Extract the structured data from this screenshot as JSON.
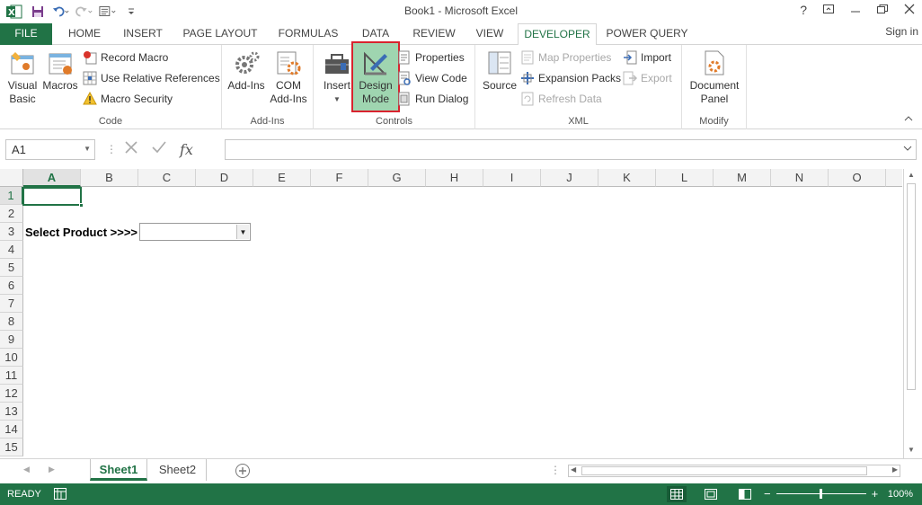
{
  "app": {
    "title": "Book1 - Microsoft Excel",
    "sign_in": "Sign in",
    "brand_color": "#217346"
  },
  "tabs": [
    "FILE",
    "HOME",
    "INSERT",
    "PAGE LAYOUT",
    "FORMULAS",
    "DATA",
    "REVIEW",
    "VIEW",
    "DEVELOPER",
    "POWER QUERY"
  ],
  "active_tab": "DEVELOPER",
  "ribbon": {
    "code": {
      "label": "Code",
      "visual_basic": [
        "Visual",
        "Basic"
      ],
      "macros": "Macros",
      "record_macro": "Record Macro",
      "use_relative": "Use Relative References",
      "macro_security": "Macro Security"
    },
    "addins": {
      "label": "Add-Ins",
      "add_ins": "Add-Ins",
      "com_add_ins": [
        "COM",
        "Add-Ins"
      ]
    },
    "controls": {
      "label": "Controls",
      "insert": "Insert",
      "design_mode": [
        "Design",
        "Mode"
      ],
      "properties": "Properties",
      "view_code": "View Code",
      "run_dialog": "Run Dialog"
    },
    "xml": {
      "label": "XML",
      "source": "Source",
      "map_properties": "Map Properties",
      "expansion_packs": "Expansion Packs",
      "refresh_data": "Refresh Data",
      "import": "Import",
      "export": "Export"
    },
    "modify": {
      "label": "Modify",
      "document_panel": [
        "Document",
        "Panel"
      ]
    }
  },
  "formula_bar": {
    "name_box": "A1",
    "fx": "fx",
    "value": ""
  },
  "grid": {
    "columns": [
      "A",
      "B",
      "C",
      "D",
      "E",
      "F",
      "G",
      "H",
      "I",
      "J",
      "K",
      "L",
      "M",
      "N",
      "O"
    ],
    "rows": [
      "1",
      "2",
      "3",
      "4",
      "5",
      "6",
      "7",
      "8",
      "9",
      "10",
      "11",
      "12",
      "13",
      "14",
      "15"
    ],
    "selected_cell": "A1",
    "a3_text": "Select Product >>>>",
    "combo_value": ""
  },
  "sheets": [
    "Sheet1",
    "Sheet2"
  ],
  "active_sheet": "Sheet1",
  "status": {
    "ready": "READY",
    "zoom": "100%"
  }
}
